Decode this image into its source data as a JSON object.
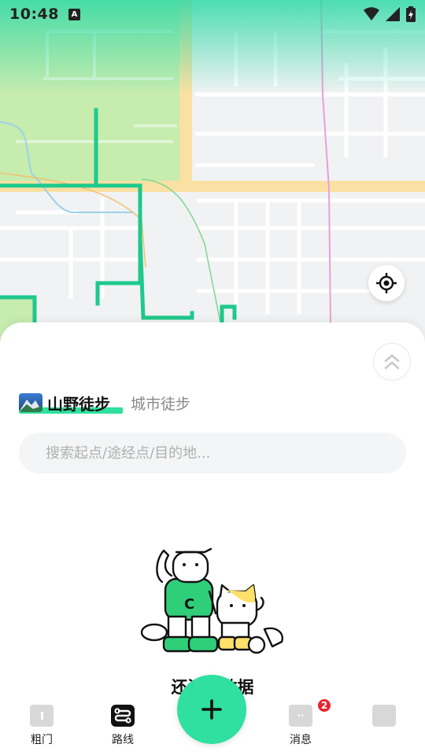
{
  "status_bar": {
    "time": "10:48",
    "notification_badge": "A"
  },
  "map": {
    "route_color": "#1ec98c",
    "road_color": "#fbe0a3",
    "locate_icon": "target-icon"
  },
  "sheet": {
    "tabs": [
      {
        "label": "山野徒步",
        "active": true
      },
      {
        "label": "城市徒步",
        "active": false
      }
    ],
    "search": {
      "placeholder": "搜索起点/途经点/目的地..."
    },
    "empty_text": "还没有数据"
  },
  "bottom_nav": {
    "items": [
      {
        "label": "粗门",
        "icon": "app-home-icon"
      },
      {
        "label": "路线",
        "icon": "route-icon"
      },
      {
        "label": "消息",
        "icon": "message-icon",
        "badge": "2"
      },
      {
        "label": "",
        "icon": "profile-icon"
      }
    ],
    "fab_icon": "plus-icon"
  },
  "colors": {
    "accent": "#2fe0a0",
    "badge": "#e8262e"
  }
}
